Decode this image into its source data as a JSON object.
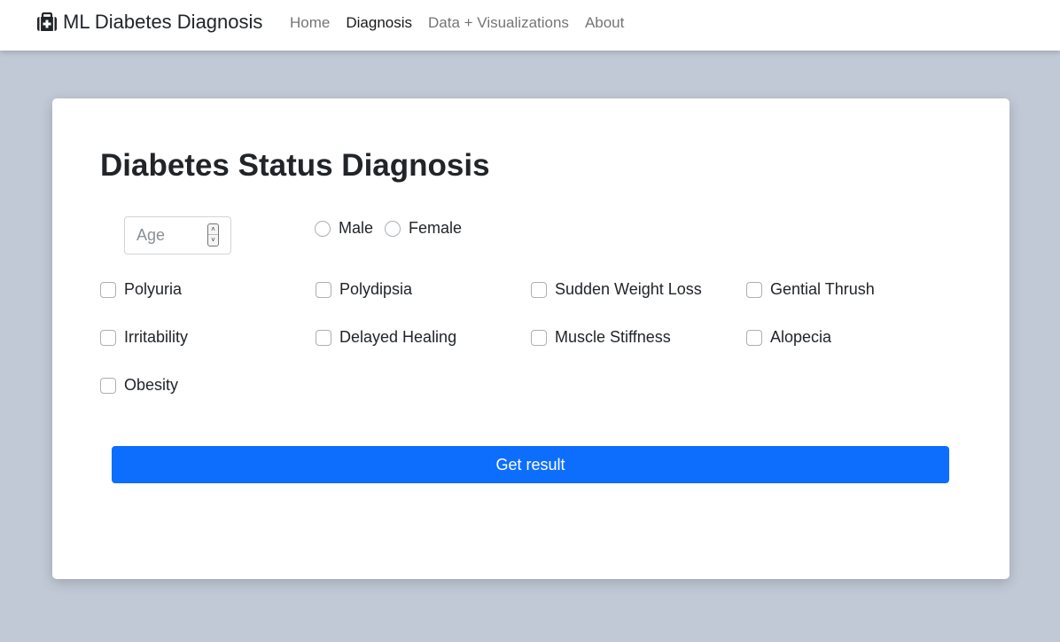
{
  "nav": {
    "brand": "ML Diabetes Diagnosis",
    "brand_icon": "medical-kit-icon",
    "links": [
      {
        "label": "Home",
        "active": false
      },
      {
        "label": "Diagnosis",
        "active": true
      },
      {
        "label": "Data + Visualizations",
        "active": false
      },
      {
        "label": "About",
        "active": false
      }
    ]
  },
  "form": {
    "title": "Diabetes Status Diagnosis",
    "age": {
      "placeholder": "Age",
      "value": ""
    },
    "gender": {
      "options": [
        "Male",
        "Female"
      ],
      "selected": null
    },
    "symptoms": [
      {
        "label": "Polyuria",
        "checked": false
      },
      {
        "label": "Polydipsia",
        "checked": false
      },
      {
        "label": "Sudden Weight Loss",
        "checked": false
      },
      {
        "label": "Gential Thrush",
        "checked": false
      },
      {
        "label": "Irritability",
        "checked": false
      },
      {
        "label": "Delayed Healing",
        "checked": false
      },
      {
        "label": "Muscle Stiffness",
        "checked": false
      },
      {
        "label": "Alopecia",
        "checked": false
      },
      {
        "label": "Obesity",
        "checked": false
      }
    ],
    "submit_label": "Get result"
  },
  "colors": {
    "primary": "#0d6efd",
    "page_bg": "#c1c9d6",
    "card_bg": "#ffffff"
  }
}
